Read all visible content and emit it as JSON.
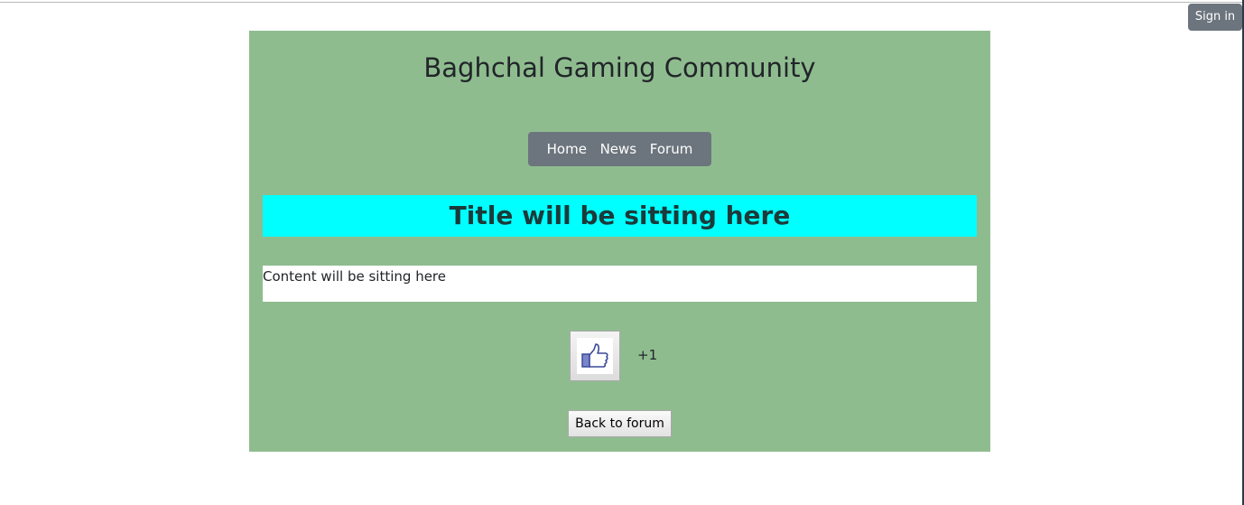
{
  "header": {
    "sign_in_label": "Sign in"
  },
  "site": {
    "title": "Baghchal Gaming Community"
  },
  "nav": {
    "items": [
      {
        "label": "Home"
      },
      {
        "label": "News"
      },
      {
        "label": "Forum"
      }
    ]
  },
  "post": {
    "title": "Title will be sitting here",
    "content": "Content will be sitting here",
    "like_icon": "thumbs-up-icon",
    "like_count": "+1",
    "back_label": "Back to forum"
  },
  "colors": {
    "panel_bg": "#8fbc8f",
    "title_bar_bg": "#00ffff",
    "nav_bg": "#6c757d",
    "signin_bg": "#6c757d"
  }
}
